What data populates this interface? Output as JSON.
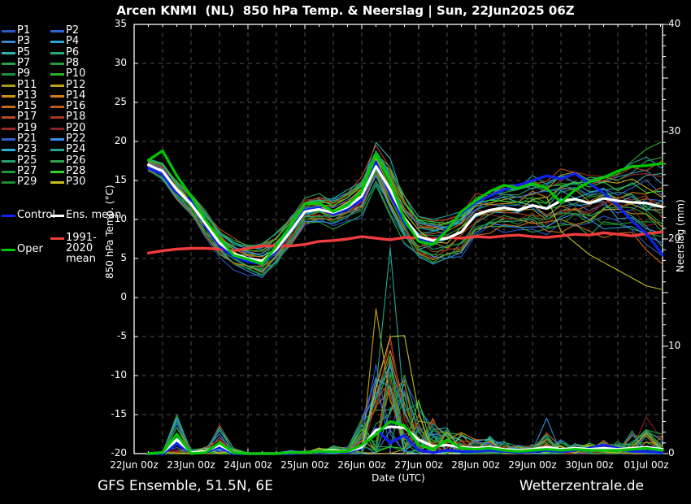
{
  "header": {
    "title": "Arcen KNMI  (NL)  850 hPa Temp. & Neerslag | Sun, 22Jun2025 06Z"
  },
  "footer": {
    "left": "GFS Ensemble, 51.5N, 6E",
    "right": "Wetterzentrale.de"
  },
  "legend": {
    "members": [
      {
        "label": "P1",
        "color": "#2d55c8"
      },
      {
        "label": "P2",
        "color": "#2d62d8"
      },
      {
        "label": "P3",
        "color": "#3c86d4"
      },
      {
        "label": "P4",
        "color": "#2ea6d6"
      },
      {
        "label": "P5",
        "color": "#2bb4b4"
      },
      {
        "label": "P6",
        "color": "#27a877"
      },
      {
        "label": "P7",
        "color": "#2aa44a"
      },
      {
        "label": "P8",
        "color": "#23a03c"
      },
      {
        "label": "P9",
        "color": "#1e9032"
      },
      {
        "label": "P10",
        "color": "#24b42a"
      },
      {
        "label": "P11",
        "color": "#a8a019"
      },
      {
        "label": "P12",
        "color": "#bfa714"
      },
      {
        "label": "P13",
        "color": "#c98f16"
      },
      {
        "label": "P14",
        "color": "#cc7d18"
      },
      {
        "label": "P15",
        "color": "#c86d20"
      },
      {
        "label": "P16",
        "color": "#bd5c1b"
      },
      {
        "label": "P17",
        "color": "#b84b1e"
      },
      {
        "label": "P18",
        "color": "#a93a1f"
      },
      {
        "label": "P19",
        "color": "#9c2a22"
      },
      {
        "label": "P20",
        "color": "#8c2120"
      },
      {
        "label": "P21",
        "color": "#2f5fd2"
      },
      {
        "label": "P22",
        "color": "#3390e8"
      },
      {
        "label": "P23",
        "color": "#2db0d6"
      },
      {
        "label": "P24",
        "color": "#21a796"
      },
      {
        "label": "P25",
        "color": "#27a06f"
      },
      {
        "label": "P26",
        "color": "#2ba34e"
      },
      {
        "label": "P27",
        "color": "#219b3a"
      },
      {
        "label": "P28",
        "color": "#2fd22f"
      },
      {
        "label": "P29",
        "color": "#1d8c2e"
      },
      {
        "label": "P30",
        "color": "#c6be1c"
      }
    ],
    "control": {
      "label": "Control",
      "color": "#1122ee"
    },
    "ens_mean": {
      "label": "Ens. mean",
      "color": "#ffffff"
    },
    "climate": {
      "label": "1991-2020 mean",
      "color": "#f03c3c"
    },
    "oper": {
      "label": "Oper",
      "color": "#00c800"
    }
  },
  "chart_data": {
    "type": "line",
    "title": "Arcen KNMI  (NL)  850 hPa Temp. & Neerslag | Sun, 22Jun2025 06Z",
    "x_axis": {
      "label": "Date (UTC)",
      "tick_hours": [
        0,
        24,
        48,
        72,
        96,
        120,
        144,
        168,
        192,
        216
      ],
      "tick_labels": [
        "22Jun 00z",
        "23Jun 00z",
        "24Jun 00z",
        "25Jun 00z",
        "26Jun 00z",
        "27Jun 00z",
        "28Jun 00z",
        "29Jun 00z",
        "30Jun 00z",
        "01Jul 00z"
      ],
      "minor_step_hours": 6,
      "grid_step_hours": 12
    },
    "y_left": {
      "label": "850 hPa Temp. (°C)",
      "min": -20,
      "max": 35,
      "tick_step": 5,
      "ticks": [
        "35",
        "30",
        "25",
        "20",
        "15",
        "10",
        "5",
        "0",
        "-5",
        "-10",
        "-15",
        "-20"
      ]
    },
    "y_right": {
      "label": "Neerslag (mm)",
      "min": 0,
      "max": 40,
      "tick_step": 10,
      "ticks": [
        "40",
        "30",
        "20",
        "10",
        "0"
      ]
    },
    "hours": [
      6,
      12,
      18,
      24,
      30,
      36,
      42,
      48,
      54,
      60,
      66,
      72,
      78,
      84,
      90,
      96,
      102,
      108,
      114,
      120,
      126,
      132,
      138,
      144,
      150,
      156,
      162,
      168,
      174,
      180,
      186,
      192,
      198,
      204,
      210,
      216,
      222
    ],
    "temperature": {
      "ens_mean": [
        17.0,
        16.2,
        13.8,
        12.0,
        9.5,
        7.0,
        5.6,
        5.0,
        4.7,
        6.2,
        8.5,
        11.0,
        11.3,
        10.9,
        11.6,
        13.0,
        16.8,
        13.8,
        10.2,
        7.8,
        7.3,
        7.6,
        8.4,
        10.6,
        11.2,
        11.5,
        11.2,
        11.8,
        11.4,
        12.4,
        12.6,
        12.1,
        12.7,
        12.4,
        12.2,
        12.1,
        11.6
      ],
      "control": [
        16.6,
        15.8,
        13.4,
        12.4,
        9.2,
        6.6,
        5.2,
        4.6,
        4.3,
        6.0,
        8.6,
        11.2,
        11.5,
        10.6,
        11.3,
        12.5,
        17.4,
        13.2,
        9.6,
        7.6,
        6.9,
        8.8,
        10.8,
        12.2,
        13.0,
        13.8,
        14.4,
        15.0,
        15.6,
        15.2,
        15.9,
        14.6,
        13.4,
        11.8,
        9.8,
        8.2,
        5.5
      ],
      "oper": [
        17.6,
        18.8,
        15.6,
        13.0,
        10.0,
        7.6,
        5.4,
        4.9,
        4.3,
        6.6,
        9.2,
        12.0,
        12.1,
        11.0,
        11.8,
        13.6,
        18.4,
        14.8,
        10.0,
        7.2,
        6.8,
        8.6,
        11.0,
        12.4,
        13.6,
        14.4,
        14.0,
        14.6,
        14.0,
        12.2,
        13.8,
        14.8,
        15.4,
        16.2,
        16.8,
        16.9,
        17.2
      ],
      "climate_1991_2020": [
        5.7,
        6.0,
        6.2,
        6.3,
        6.3,
        6.2,
        6.0,
        6.3,
        6.6,
        6.6,
        6.6,
        6.8,
        7.2,
        7.3,
        7.5,
        7.8,
        7.6,
        7.4,
        7.7,
        7.6,
        7.5,
        7.7,
        7.6,
        7.8,
        7.7,
        7.9,
        8.0,
        7.8,
        7.7,
        7.9,
        8.1,
        8.0,
        8.3,
        8.1,
        7.9,
        8.2,
        8.4
      ],
      "member_spread_half": [
        0.9,
        1.2,
        1.4,
        1.6,
        1.8,
        1.8,
        1.8,
        1.9,
        2.1,
        2.1,
        2.0,
        1.8,
        1.9,
        2.1,
        2.3,
        2.6,
        2.4,
        3.6,
        3.6,
        3.2,
        3.2,
        3.1,
        3.0,
        2.9,
        2.9,
        3.1,
        3.3,
        3.6,
        3.7,
        4.0,
        4.2,
        4.4,
        4.8,
        5.2,
        5.6,
        6.2,
        6.8
      ],
      "member_overrides": [
        {
          "member": 30,
          "start_index": 29,
          "values": [
            8.5,
            7.0,
            5.5,
            4.5,
            3.5,
            2.5,
            1.5,
            1.0
          ]
        },
        {
          "member": 5,
          "start_index": 16,
          "values": [
            19.9,
            17.8
          ]
        },
        {
          "member": 10,
          "start_index": 34,
          "values": [
            17.5,
            19.0,
            20.0
          ]
        }
      ]
    },
    "precipitation": {
      "ens_mean": [
        0,
        0.1,
        1.3,
        0.1,
        0.2,
        0.8,
        0.1,
        0,
        0,
        0,
        0.1,
        0.1,
        0.2,
        0.3,
        0.2,
        0.6,
        2.2,
        2.5,
        2.4,
        1.3,
        0.7,
        0.8,
        0.6,
        0.5,
        0.6,
        0.4,
        0.3,
        0.4,
        0.6,
        0.4,
        0.5,
        0.4,
        0.5,
        0.4,
        0.5,
        0.6,
        0.4
      ],
      "control": [
        0,
        0,
        0.9,
        0.1,
        0.1,
        0.6,
        0,
        0,
        0,
        0,
        0,
        0.1,
        0.1,
        0.2,
        0.1,
        0.5,
        2.3,
        1.0,
        1.7,
        0.3,
        0.1,
        0.3,
        0.2,
        0.2,
        0.3,
        0.2,
        0.1,
        0.2,
        0.3,
        0.2,
        0.3,
        0.5,
        0.8,
        0.5,
        0.2,
        0.2,
        0.1
      ],
      "oper": [
        0,
        0.1,
        1.8,
        0,
        0.1,
        1.0,
        0.1,
        0,
        0,
        0,
        0.1,
        0.1,
        0.2,
        0.2,
        0.2,
        0.8,
        1.8,
        3.0,
        2.6,
        0.8,
        0.4,
        1.3,
        0.5,
        0.4,
        0.5,
        0.3,
        0.2,
        0.3,
        0.4,
        0.3,
        0.4,
        0.3,
        0.3,
        0.3,
        0.4,
        0.5,
        0.3
      ],
      "member_envelope_max": [
        0,
        0.2,
        3.6,
        0.4,
        0.6,
        2.7,
        0.5,
        0.1,
        0.1,
        0.1,
        0.3,
        0.3,
        0.6,
        0.8,
        0.6,
        3.5,
        9.0,
        12.0,
        8.0,
        5.0,
        3.5,
        2.5,
        2.0,
        1.5,
        1.8,
        1.2,
        0.8,
        1.0,
        2.0,
        1.5,
        1.2,
        1.0,
        1.4,
        1.2,
        2.2,
        2.5,
        2.0
      ],
      "member_spikes": [
        {
          "member": 24,
          "index": 17,
          "mm": 19.2
        },
        {
          "member": 24,
          "index": 16,
          "mm": 6.0
        },
        {
          "member": 24,
          "index": 18,
          "mm": 4.0
        },
        {
          "member": 12,
          "index": 16,
          "mm": 13.5
        },
        {
          "member": 12,
          "index": 17,
          "mm": 5.0
        },
        {
          "member": 30,
          "index": 18,
          "mm": 11.0
        },
        {
          "member": 21,
          "index": 16,
          "mm": 8.3
        },
        {
          "member": 15,
          "index": 17,
          "mm": 9.0
        },
        {
          "member": 19,
          "index": 5,
          "mm": 2.7
        },
        {
          "member": 7,
          "index": 2,
          "mm": 3.6
        },
        {
          "member": 22,
          "index": 28,
          "mm": 3.3
        },
        {
          "member": 20,
          "index": 35,
          "mm": 3.4
        },
        {
          "member": 26,
          "index": 35,
          "mm": 2.2
        },
        {
          "member": 26,
          "index": 36,
          "mm": 1.8
        }
      ]
    },
    "colors": {
      "background": "#000000",
      "grid": "#4f4f45",
      "axis": "#ffffff",
      "text": "#ffffff"
    }
  }
}
